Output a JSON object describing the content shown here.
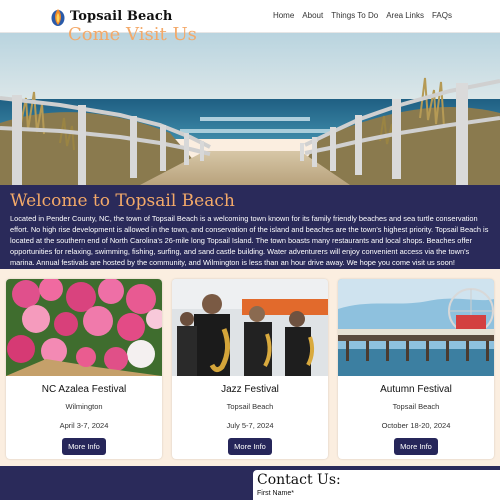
{
  "nav": {
    "brand": "Topsail Beach",
    "links": [
      "Home",
      "About",
      "Things To Do",
      "Area Links",
      "FAQs"
    ]
  },
  "hero": {
    "icon": "beach-boardwalk-photo"
  },
  "welcome": {
    "title": "Welcome to Topsail Beach",
    "text": "Located in Pender County, NC, the town of Topsail Beach is a welcoming town known for its family friendly beaches and sea turtle conservation effort. No high rise development is allowed in the town, and conservation of the island and beaches are the town's highest priority. Topsail Beach is located at the southern end of North Carolina's 26-mile long Topsail Island. The town boasts many restaurants and local shops. Beaches offer opportunities for relaxing, swimming, fishing, surfing, and sand castle building. Water adventurers will enjoy convenient access via the town's marina. Annual festivals are hosted by the community, and Wilmington is less than an hour drive away. We hope you come visit us soon!"
  },
  "events": [
    {
      "title": "NC Azalea Festival",
      "location": "Wilmington",
      "date": "April 3-7, 2024",
      "button": "More Info"
    },
    {
      "title": "Jazz Festival",
      "location": "Topsail Beach",
      "date": "July 5-7, 2024",
      "button": "More Info"
    },
    {
      "title": "Autumn Festival",
      "location": "Topsail Beach",
      "date": "October 18-20, 2024",
      "button": "More Info"
    }
  ],
  "visit": {
    "title": "Come Visit Us"
  },
  "contact": {
    "title": "Contact Us:",
    "first_name_label": "First Name*"
  },
  "colors": {
    "accent": "#f3a969",
    "navy": "#2a2a5a",
    "cream": "#fbeee0"
  }
}
